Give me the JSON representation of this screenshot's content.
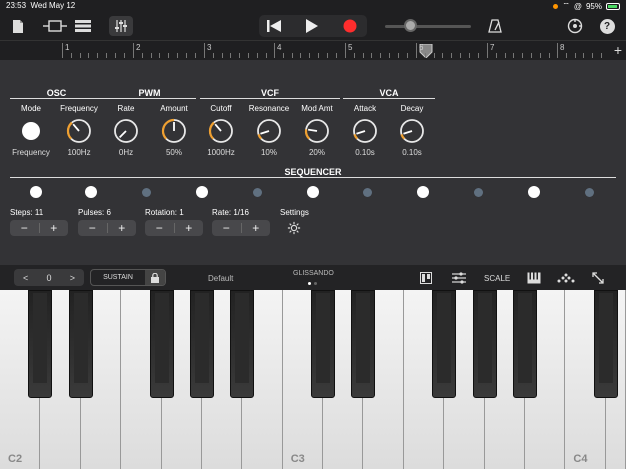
{
  "status": {
    "time": "23:53",
    "date": "Wed May 12",
    "battery": "95%"
  },
  "toolbar": {
    "icons": [
      "document-icon",
      "tracks-view-icon",
      "list-view-icon",
      "mixer-icon"
    ],
    "transport": [
      "rewind-icon",
      "play-icon",
      "record-icon"
    ],
    "right_icons": [
      "metronome-icon",
      "settings-icon",
      "help-icon"
    ],
    "help": "?",
    "record_color": "#ff2d2d"
  },
  "ruler": {
    "bars": [
      "1",
      "2",
      "3",
      "4",
      "5",
      "6",
      "7",
      "8"
    ],
    "add": "+"
  },
  "sections": [
    {
      "title": "OSC"
    },
    {
      "title": "PWM"
    },
    {
      "title": "VCF"
    },
    {
      "title": "VCA"
    }
  ],
  "params": [
    {
      "label": "Mode",
      "value": "Frequency",
      "level": null
    },
    {
      "label": "Frequency",
      "value": "100Hz",
      "level": 0.35
    },
    {
      "label": "Rate",
      "value": "0Hz",
      "level": 0.0
    },
    {
      "label": "Amount",
      "value": "50%",
      "level": 0.5
    },
    {
      "label": "Cutoff",
      "value": "1000Hz",
      "level": 0.35
    },
    {
      "label": "Resonance",
      "value": "10%",
      "level": 0.1
    },
    {
      "label": "Mod Amt",
      "value": "20%",
      "level": 0.2
    },
    {
      "label": "Attack",
      "value": "0.10s",
      "level": 0.1
    },
    {
      "label": "Decay",
      "value": "0.10s",
      "level": 0.1
    }
  ],
  "sequencer": {
    "title": "SEQUENCER",
    "steps": [
      true,
      true,
      false,
      true,
      false,
      true,
      false,
      true,
      false,
      true,
      false
    ],
    "controls": [
      {
        "label": "Steps: 11",
        "minus": "−",
        "plus": "+"
      },
      {
        "label": "Pulses: 6",
        "minus": "−",
        "plus": "+"
      },
      {
        "label": "Rotation: 1",
        "minus": "−",
        "plus": "+"
      },
      {
        "label": "Rate: 1/16",
        "minus": "−",
        "plus": "+"
      }
    ],
    "settings_label": "Settings"
  },
  "keyboard_bar": {
    "prev": "<",
    "octave": "0",
    "next": ">",
    "sustain": "SUSTAIN",
    "preset": "Default",
    "mode": "GLISSANDO",
    "page_dots": 2,
    "page_active": 0,
    "scale": "SCALE"
  },
  "keyboard": {
    "white_keys": 15,
    "labels": [
      {
        "key": 0,
        "text": "C2"
      },
      {
        "key": 7,
        "text": "C3"
      },
      {
        "key": 14,
        "text": "C4"
      }
    ],
    "black_after": [
      0,
      1,
      3,
      4,
      5,
      7,
      8,
      10,
      11,
      12,
      14
    ]
  }
}
